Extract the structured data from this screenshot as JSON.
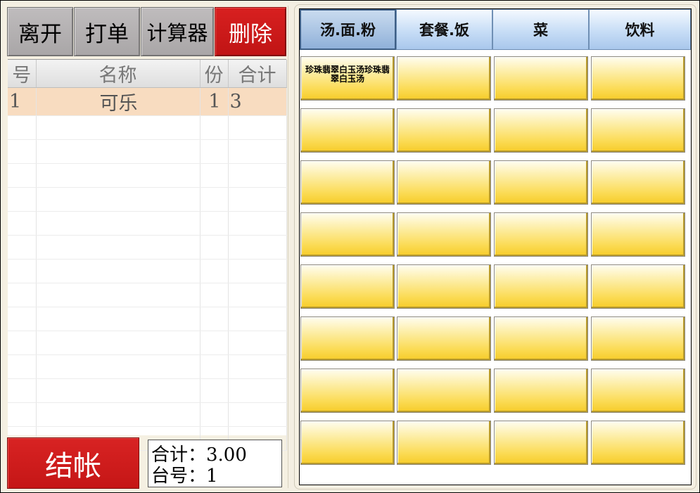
{
  "toolbar": {
    "leave_label": "离开",
    "print_label": "打单",
    "calculator_label": "计算器",
    "delete_label": "删除"
  },
  "order": {
    "columns": [
      "号",
      "名称",
      "份",
      "合计"
    ],
    "rows": [
      [
        "1",
        "可乐",
        "1",
        "3"
      ]
    ]
  },
  "checkout_label": "结帐",
  "summary": {
    "total_text": "合计：3.00",
    "table_text": "台号：1"
  },
  "categories": [
    "汤.面.粉",
    "套餐.饭",
    "菜",
    "饮料"
  ],
  "dishes": [
    "珍珠翡翠白玉汤珍珠翡翠白玉汤"
  ],
  "colors": {
    "accent_red": "#c81a1a",
    "tab_blue": "#b9d3f0",
    "dish_yellow": "#f9d544",
    "selected_row": "#f8dcc0"
  }
}
